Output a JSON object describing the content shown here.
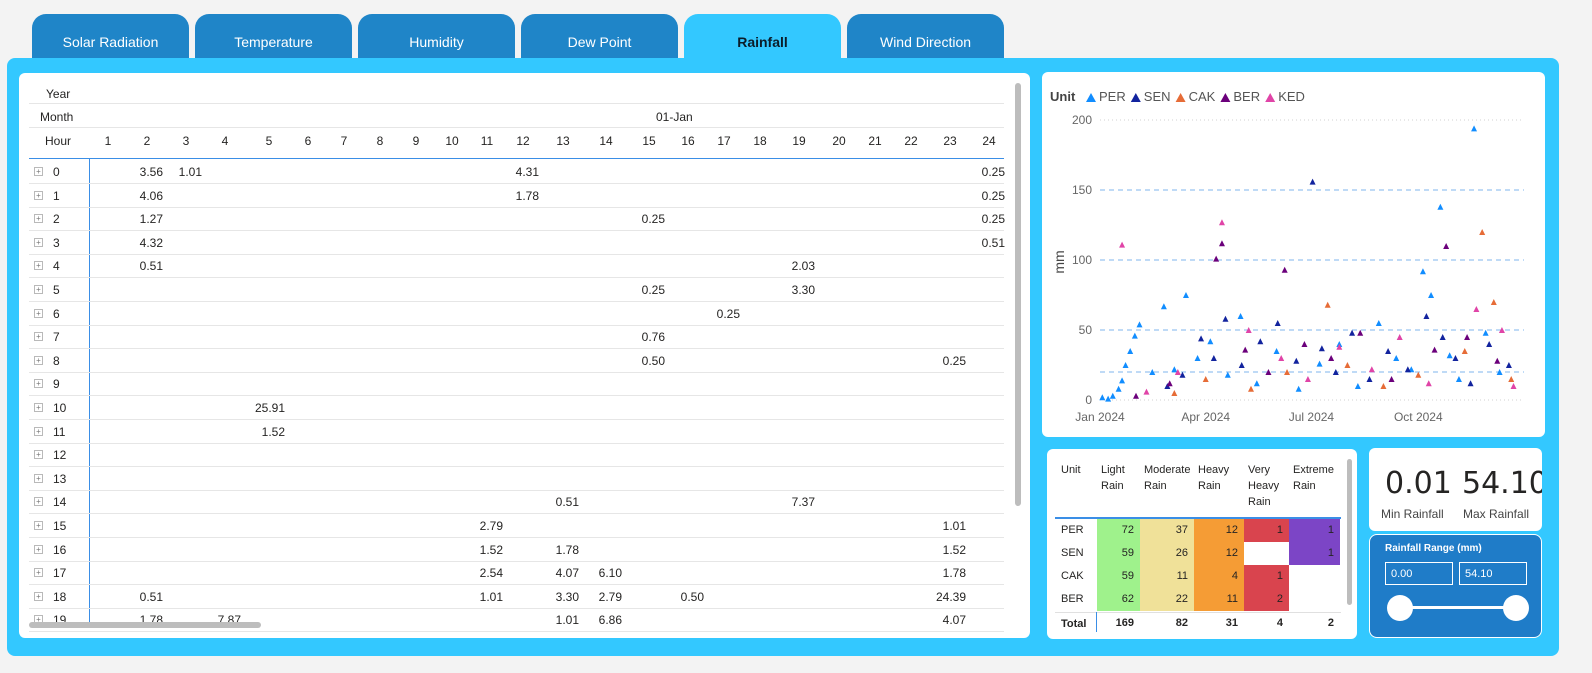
{
  "tabs": [
    {
      "label": "Solar Radiation",
      "active": false
    },
    {
      "label": "Temperature",
      "active": false
    },
    {
      "label": "Humidity",
      "active": false
    },
    {
      "label": "Dew Point",
      "active": false
    },
    {
      "label": "Rainfall",
      "active": true
    },
    {
      "label": "Wind Direction",
      "active": false
    }
  ],
  "matrix": {
    "year_label": "Year",
    "month_label": "Month",
    "month_value": "01-Jan",
    "hour_label": "Hour",
    "columns": [
      "1",
      "2",
      "3",
      "4",
      "5",
      "6",
      "7",
      "8",
      "9",
      "10",
      "11",
      "12",
      "13",
      "14",
      "15",
      "16",
      "17",
      "18",
      "19",
      "20",
      "21",
      "22",
      "23",
      "24"
    ],
    "rows": [
      {
        "hour": "0",
        "cells": {
          "2": "3.56",
          "3": "1.01",
          "12": "4.31",
          "24": "0.25"
        }
      },
      {
        "hour": "1",
        "cells": {
          "2": "4.06",
          "12": "1.78",
          "24": "0.25"
        }
      },
      {
        "hour": "2",
        "cells": {
          "2": "1.27",
          "15": "0.25",
          "24": "0.25"
        }
      },
      {
        "hour": "3",
        "cells": {
          "2": "4.32",
          "24": "0.51"
        }
      },
      {
        "hour": "4",
        "cells": {
          "2": "0.51",
          "19": "2.03"
        }
      },
      {
        "hour": "5",
        "cells": {
          "15": "0.25",
          "19": "3.30"
        }
      },
      {
        "hour": "6",
        "cells": {
          "17": "0.25"
        }
      },
      {
        "hour": "7",
        "cells": {
          "15": "0.76"
        }
      },
      {
        "hour": "8",
        "cells": {
          "15": "0.50",
          "23": "0.25"
        }
      },
      {
        "hour": "9",
        "cells": {}
      },
      {
        "hour": "10",
        "cells": {
          "5": "25.91"
        }
      },
      {
        "hour": "11",
        "cells": {
          "5": "1.52"
        }
      },
      {
        "hour": "12",
        "cells": {}
      },
      {
        "hour": "13",
        "cells": {}
      },
      {
        "hour": "14",
        "cells": {
          "13": "0.51",
          "19": "7.37"
        }
      },
      {
        "hour": "15",
        "cells": {
          "11": "2.79",
          "23": "1.01"
        }
      },
      {
        "hour": "16",
        "cells": {
          "11": "1.52",
          "13": "1.78",
          "23": "1.52"
        }
      },
      {
        "hour": "17",
        "cells": {
          "11": "2.54",
          "13": "4.07",
          "14": "6.10",
          "23": "1.78"
        }
      },
      {
        "hour": "18",
        "cells": {
          "2": "0.51",
          "11": "1.01",
          "13": "3.30",
          "14": "2.79",
          "16": "0.50",
          "23": "24.39"
        }
      },
      {
        "hour": "19",
        "cells": {
          "2": "1.78",
          "4": "7.87",
          "13": "1.01",
          "14": "6.86",
          "23": "4.07"
        }
      }
    ]
  },
  "chart_data": {
    "type": "scatter",
    "legend_title": "Unit",
    "legend_position": "top-left",
    "ylabel": "mm",
    "ylim": [
      0,
      200
    ],
    "yticks": [
      0,
      50,
      100,
      150,
      200
    ],
    "xticks": [
      "Jan 2024",
      "Apr 2024",
      "Jul 2024",
      "Oct 2024"
    ],
    "xlim": [
      "2024-01-01",
      "2024-12-31"
    ],
    "reference_lines": [
      20,
      50,
      100,
      150
    ],
    "series": [
      {
        "name": "PER",
        "color": "#118dff",
        "points": [
          [
            "2024-01-03",
            2
          ],
          [
            "2024-01-08",
            1
          ],
          [
            "2024-01-12",
            3
          ],
          [
            "2024-01-17",
            8
          ],
          [
            "2024-01-20",
            14
          ],
          [
            "2024-01-23",
            25
          ],
          [
            "2024-01-27",
            35
          ],
          [
            "2024-01-31",
            46
          ],
          [
            "2024-02-04",
            54
          ],
          [
            "2024-02-15",
            20
          ],
          [
            "2024-02-25",
            67
          ],
          [
            "2024-03-05",
            22
          ],
          [
            "2024-03-15",
            75
          ],
          [
            "2024-03-25",
            30
          ],
          [
            "2024-04-05",
            42
          ],
          [
            "2024-04-20",
            18
          ],
          [
            "2024-05-01",
            60
          ],
          [
            "2024-05-15",
            12
          ],
          [
            "2024-06-01",
            35
          ],
          [
            "2024-06-20",
            8
          ],
          [
            "2024-07-08",
            26
          ],
          [
            "2024-07-25",
            40
          ],
          [
            "2024-08-10",
            10
          ],
          [
            "2024-08-28",
            55
          ],
          [
            "2024-09-12",
            30
          ],
          [
            "2024-09-25",
            22
          ],
          [
            "2024-10-05",
            92
          ],
          [
            "2024-10-12",
            75
          ],
          [
            "2024-10-20",
            138
          ],
          [
            "2024-10-28",
            32
          ],
          [
            "2024-11-05",
            15
          ],
          [
            "2024-11-18",
            194
          ],
          [
            "2024-11-28",
            48
          ],
          [
            "2024-12-10",
            20
          ]
        ]
      },
      {
        "name": "SEN",
        "color": "#12239e",
        "points": [
          [
            "2024-02-28",
            10
          ],
          [
            "2024-03-12",
            18
          ],
          [
            "2024-03-28",
            44
          ],
          [
            "2024-04-08",
            30
          ],
          [
            "2024-04-18",
            58
          ],
          [
            "2024-05-02",
            25
          ],
          [
            "2024-05-18",
            42
          ],
          [
            "2024-06-02",
            55
          ],
          [
            "2024-06-18",
            28
          ],
          [
            "2024-07-02",
            156
          ],
          [
            "2024-07-10",
            37
          ],
          [
            "2024-07-22",
            20
          ],
          [
            "2024-08-05",
            48
          ],
          [
            "2024-08-20",
            15
          ],
          [
            "2024-09-05",
            35
          ],
          [
            "2024-09-22",
            22
          ],
          [
            "2024-10-08",
            60
          ],
          [
            "2024-10-22",
            45
          ],
          [
            "2024-11-02",
            30
          ],
          [
            "2024-11-15",
            12
          ],
          [
            "2024-12-01",
            40
          ],
          [
            "2024-12-18",
            25
          ]
        ]
      },
      {
        "name": "CAK",
        "color": "#e66c37",
        "points": [
          [
            "2024-03-05",
            5
          ],
          [
            "2024-04-01",
            15
          ],
          [
            "2024-05-10",
            8
          ],
          [
            "2024-06-10",
            20
          ],
          [
            "2024-07-15",
            68
          ],
          [
            "2024-08-01",
            25
          ],
          [
            "2024-09-01",
            10
          ],
          [
            "2024-10-01",
            18
          ],
          [
            "2024-11-10",
            35
          ],
          [
            "2024-11-25",
            120
          ],
          [
            "2024-12-05",
            70
          ],
          [
            "2024-12-20",
            15
          ]
        ]
      },
      {
        "name": "BER",
        "color": "#6b007b",
        "points": [
          [
            "2024-02-01",
            3
          ],
          [
            "2024-03-01",
            12
          ],
          [
            "2024-04-10",
            101
          ],
          [
            "2024-04-15",
            112
          ],
          [
            "2024-05-05",
            36
          ],
          [
            "2024-05-25",
            20
          ],
          [
            "2024-06-08",
            93
          ],
          [
            "2024-06-25",
            40
          ],
          [
            "2024-07-18",
            30
          ],
          [
            "2024-08-12",
            48
          ],
          [
            "2024-09-08",
            15
          ],
          [
            "2024-10-15",
            36
          ],
          [
            "2024-10-25",
            110
          ],
          [
            "2024-11-12",
            45
          ],
          [
            "2024-12-08",
            28
          ]
        ]
      },
      {
        "name": "KED",
        "color": "#e044a7",
        "points": [
          [
            "2024-01-20",
            111
          ],
          [
            "2024-02-10",
            6
          ],
          [
            "2024-03-08",
            20
          ],
          [
            "2024-04-15",
            127
          ],
          [
            "2024-05-08",
            50
          ],
          [
            "2024-06-05",
            30
          ],
          [
            "2024-06-28",
            15
          ],
          [
            "2024-07-25",
            38
          ],
          [
            "2024-08-22",
            22
          ],
          [
            "2024-09-15",
            45
          ],
          [
            "2024-10-10",
            12
          ],
          [
            "2024-11-20",
            65
          ],
          [
            "2024-12-12",
            50
          ],
          [
            "2024-12-22",
            10
          ]
        ]
      }
    ]
  },
  "category_table": {
    "headers": [
      "Unit",
      "Light Rain",
      "Moderate Rain",
      "Heavy Rain",
      "Very Heavy Rain",
      "Extreme Rain"
    ],
    "rows": [
      {
        "unit": "PER",
        "values": [
          "72",
          "37",
          "12",
          "1",
          "1"
        ]
      },
      {
        "unit": "SEN",
        "values": [
          "59",
          "26",
          "12",
          "",
          "1"
        ]
      },
      {
        "unit": "CAK",
        "values": [
          "59",
          "11",
          "4",
          "1",
          ""
        ]
      },
      {
        "unit": "BER",
        "values": [
          "62",
          "22",
          "11",
          "2",
          ""
        ]
      }
    ],
    "total_label": "Total",
    "totals": [
      "169",
      "82",
      "31",
      "4",
      "2"
    ],
    "column_colors": [
      "#9ff28c",
      "#f0e199",
      "#f59c35",
      "#d9444e",
      "#7c45c6"
    ]
  },
  "kpis": {
    "min_value": "0.01",
    "min_label": "Min Rainfall",
    "max_value": "54.10",
    "max_label": "Max Rainfall"
  },
  "slicer": {
    "title": "Rainfall Range (mm)",
    "min_value": "0.00",
    "max_value": "54.10"
  }
}
